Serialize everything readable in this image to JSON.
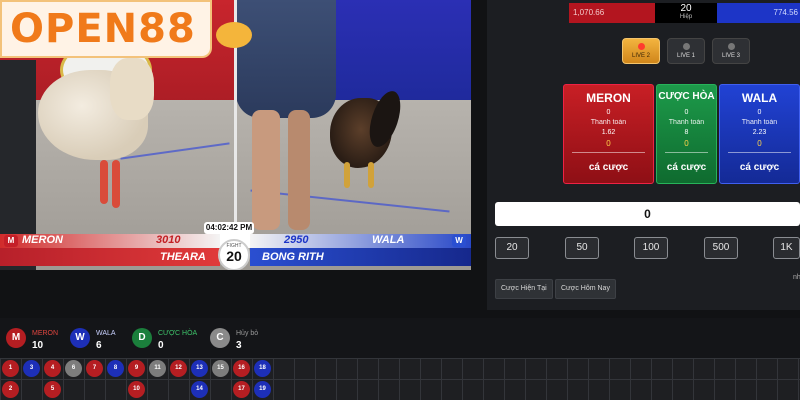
{
  "brand": {
    "logo_text": "OPEN88"
  },
  "stream": {
    "time": "04:02:42 PM",
    "meron_label": "MERON",
    "meron_score": "3010",
    "wala_score": "2950",
    "wala_label": "WALA",
    "fight_label": "FIGHT",
    "fight_number": "20",
    "meron_owner": "THEARA",
    "wala_owner": "BONG RITH",
    "badge_m": "M",
    "badge_w": "W"
  },
  "topbar": {
    "meron_amount": "1,070.66",
    "round_number": "20",
    "round_label": "Hiệp",
    "wala_amount": "774.56"
  },
  "live_buttons": [
    {
      "label": "LIVE 2",
      "active": true
    },
    {
      "label": "LIVE 1",
      "active": false
    },
    {
      "label": "LIVE 3",
      "active": false
    }
  ],
  "bet_cards": {
    "meron": {
      "title": "MERON",
      "v1": "0",
      "pay_label": "Thanh toán",
      "odds": "1.62",
      "amount": "0",
      "cta": "cá cược"
    },
    "draw": {
      "title": "CƯỢC HÒA",
      "v1": "0",
      "pay_label": "Thanh toán",
      "odds": "8",
      "amount": "0",
      "cta": "cá cược"
    },
    "wala": {
      "title": "WALA",
      "v1": "0",
      "pay_label": "Thanh toán",
      "odds": "2.23",
      "amount": "0",
      "cta": "cá cược"
    }
  },
  "bet_amount": "0",
  "chips": [
    "20",
    "50",
    "100",
    "500",
    "1K"
  ],
  "tabs": [
    "Cược Hiện Tại",
    "Cược Hôm Nay"
  ],
  "corner_text": "nh",
  "stats": [
    {
      "letter": "M",
      "name": "MERON",
      "count": "10",
      "color": "#b51e22",
      "name_color": "#e0453f"
    },
    {
      "letter": "W",
      "name": "WALA",
      "count": "6",
      "color": "#1d2fb8",
      "name_color": "#c9d1ff"
    },
    {
      "letter": "D",
      "name": "CƯỢC HÒA",
      "count": "0",
      "color": "#1b7f3c",
      "name_color": "#3ec46a"
    },
    {
      "letter": "C",
      "name": "Hủy bỏ",
      "count": "3",
      "color": "#8a8a8a",
      "name_color": "#9a9a9a"
    }
  ],
  "roadmap": {
    "row1": [
      {
        "n": "1",
        "c": "r"
      },
      {
        "n": "3",
        "c": "b"
      },
      {
        "n": "4",
        "c": "r"
      },
      {
        "n": "6",
        "c": "g"
      },
      {
        "n": "7",
        "c": "r"
      },
      {
        "n": "8",
        "c": "b"
      },
      {
        "n": "9",
        "c": "r"
      },
      {
        "n": "11",
        "c": "g"
      },
      {
        "n": "12",
        "c": "r"
      },
      {
        "n": "13",
        "c": "b"
      },
      {
        "n": "15",
        "c": "g"
      },
      {
        "n": "16",
        "c": "r"
      },
      {
        "n": "18",
        "c": "b"
      }
    ],
    "row2": [
      {
        "col": 0,
        "n": "2",
        "c": "r"
      },
      {
        "col": 2,
        "n": "5",
        "c": "r"
      },
      {
        "col": 6,
        "n": "10",
        "c": "r"
      },
      {
        "col": 9,
        "n": "14",
        "c": "b"
      },
      {
        "col": 11,
        "n": "17",
        "c": "r"
      },
      {
        "col": 12,
        "n": "19",
        "c": "b"
      }
    ]
  }
}
